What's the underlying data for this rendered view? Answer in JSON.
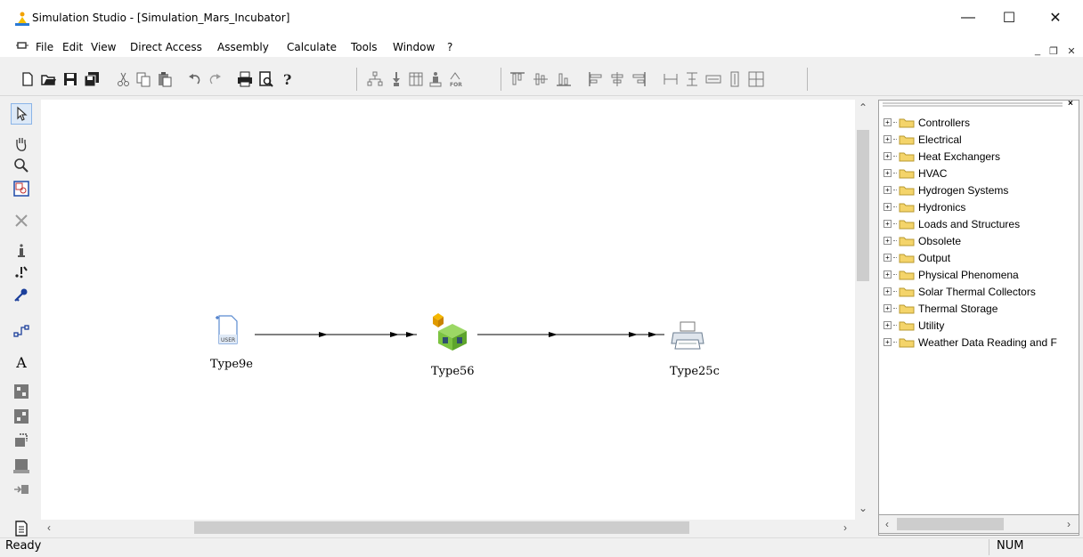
{
  "window": {
    "title": "Simulation Studio - [Simulation_Mars_Incubator]",
    "controls": {
      "minimize": "—",
      "maximize": "☐",
      "close": "✕"
    }
  },
  "menubar": {
    "items": [
      "File",
      "Edit",
      "View",
      "Direct Access",
      "Assembly",
      "Calculate",
      "Tools",
      "Window",
      "?"
    ],
    "mdi_controls": {
      "minimize": "_",
      "restore": "❐",
      "close": "✕"
    }
  },
  "toolbar": {
    "icons": [
      "new-icon",
      "open-icon",
      "save-icon",
      "save-all-icon",
      "cut-icon",
      "copy-icon",
      "paste-icon",
      "undo-icon",
      "redo-icon",
      "print-icon",
      "print-preview-icon",
      "help-icon",
      "macro-icon",
      "import-icon",
      "table-icon",
      "figure-icon",
      "for-icon",
      "align-top-icon",
      "align-center-icon",
      "align-bottom-icon",
      "align-left-icon",
      "align-middle-icon",
      "align-right-icon",
      "same-width-icon",
      "same-height-icon",
      "same-size-icon",
      "space-vertical-icon",
      "space-grid-icon"
    ]
  },
  "left_toolbar": {
    "icons": [
      "pointer-icon",
      "hand-icon",
      "zoom-icon",
      "zoom-box-icon",
      "delete-icon",
      "info-icon",
      "link-icon",
      "key-icon",
      "connect-icon",
      "text-icon",
      "component-icon",
      "component2-icon",
      "export-icon",
      "macro-component-icon",
      "plugin-icon",
      "document-icon"
    ],
    "text_tool_label": "A"
  },
  "diagram": {
    "components": [
      {
        "name": "Type9e",
        "icon": "user-file-icon",
        "badge": "USER"
      },
      {
        "name": "Type56",
        "icon": "building-icon"
      },
      {
        "name": "Type25c",
        "icon": "printer-icon"
      }
    ]
  },
  "library_tree": {
    "items": [
      "Controllers",
      "Electrical",
      "Heat Exchangers",
      "HVAC",
      "Hydrogen Systems",
      "Hydronics",
      "Loads and Structures",
      "Obsolete",
      "Output",
      "Physical Phenomena",
      "Solar Thermal Collectors",
      "Thermal Storage",
      "Utility",
      "Weather Data Reading and F"
    ],
    "expander": "+"
  },
  "statusbar": {
    "status": "Ready",
    "num": "NUM"
  },
  "colors": {
    "folder": "#f4d46a",
    "building_green": "#7cc341",
    "accent_orange": "#f5b800"
  }
}
